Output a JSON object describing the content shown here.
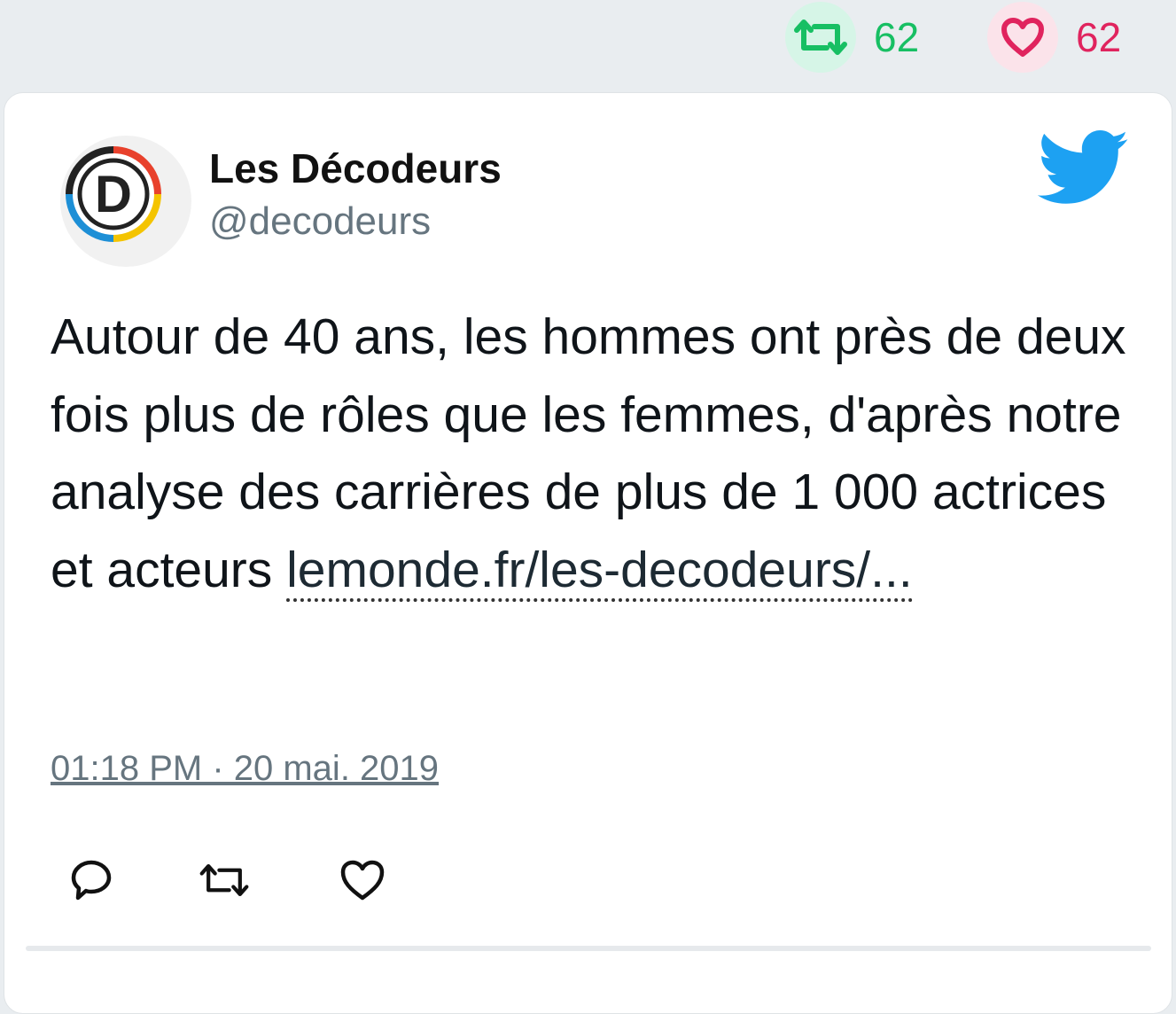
{
  "stats": {
    "retweets": "62",
    "likes": "62",
    "retweet_color": "#17bf63",
    "like_color": "#e0245e"
  },
  "tweet": {
    "author_name": "Les Décodeurs",
    "author_handle": "@decodeurs",
    "avatar_letter": "D",
    "text": "Autour de 40 ans, les hommes ont près de deux fois plus de rôles que les femmes, d'après notre analyse des carrières de plus de 1 000 actrices et acteurs ",
    "link_text": "lemonde.fr/les-decodeurs/...",
    "timestamp": "01:18 PM · 20 mai. 2019"
  },
  "icons": {
    "stats_retweet": "retweet-icon",
    "stats_like": "heart-icon",
    "brand": "twitter-bird-icon",
    "reply": "reply-icon",
    "retweet": "retweet-icon",
    "like": "heart-icon"
  },
  "colors": {
    "twitter_blue": "#1da1f2",
    "muted_text": "#66757f"
  }
}
